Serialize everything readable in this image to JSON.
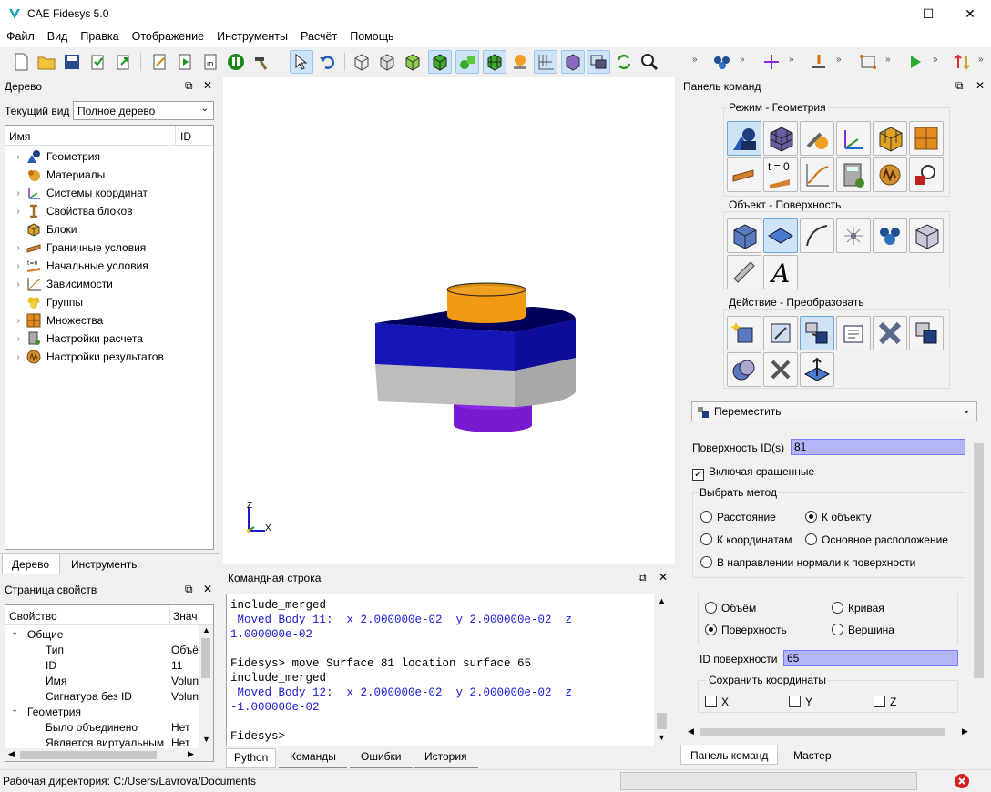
{
  "window": {
    "title": "CAE Fidesys 5.0",
    "min": "—",
    "max": "☐",
    "close": "✕"
  },
  "menu": [
    "Файл",
    "Вид",
    "Правка",
    "Отображение",
    "Инструменты",
    "Расчёт",
    "Помощь"
  ],
  "tree_panel": {
    "title": "Дерево",
    "view_label": "Текущий вид",
    "view_value": "Полное дерево",
    "col_name": "Имя",
    "col_id": "ID",
    "items": [
      {
        "label": "Геометрия",
        "icon": "geometry-icon",
        "expandable": true
      },
      {
        "label": "Материалы",
        "icon": "materials-icon",
        "expandable": false
      },
      {
        "label": "Системы координат",
        "icon": "axes-icon",
        "expandable": true
      },
      {
        "label": "Свойства блоков",
        "icon": "beam-icon",
        "expandable": true
      },
      {
        "label": "Блоки",
        "icon": "blocks-icon",
        "expandable": false
      },
      {
        "label": "Граничные условия",
        "icon": "boundary-icon",
        "expandable": true
      },
      {
        "label": "Начальные условия",
        "icon": "initial-icon",
        "expandable": true
      },
      {
        "label": "Зависимости",
        "icon": "graph-icon",
        "expandable": true
      },
      {
        "label": "Группы",
        "icon": "groups-icon",
        "expandable": false
      },
      {
        "label": "Множества",
        "icon": "sets-icon",
        "expandable": true
      },
      {
        "label": "Настройки расчета",
        "icon": "calc-settings-icon",
        "expandable": true
      },
      {
        "label": "Настройки результатов",
        "icon": "results-icon",
        "expandable": true
      }
    ],
    "tabs": [
      "Дерево",
      "Инструменты"
    ]
  },
  "props_panel": {
    "title": "Страница свойств",
    "col_prop": "Свойство",
    "col_val": "Знач",
    "rows": [
      {
        "name": "Общие",
        "value": "",
        "level": 0,
        "group": true
      },
      {
        "name": "Тип",
        "value": "Объё",
        "level": 1
      },
      {
        "name": "ID",
        "value": "11",
        "level": 1
      },
      {
        "name": "Имя",
        "value": "Volun",
        "level": 1
      },
      {
        "name": "Сигнатура без ID",
        "value": "Volun",
        "level": 1
      },
      {
        "name": "Геометрия",
        "value": "",
        "level": 0,
        "group": true
      },
      {
        "name": "Было объединено",
        "value": "Нет",
        "level": 1
      },
      {
        "name": "Является виртуальным",
        "value": "Нет",
        "level": 1
      }
    ]
  },
  "viewport": {
    "axis_z": "Z",
    "axis_x": "X"
  },
  "command_panel": {
    "title": "Командная строка",
    "lines": [
      {
        "text": "include_merged",
        "style": "plain"
      },
      {
        "text": " Moved Body 11:  x 2.000000e-02  y 2.000000e-02  z",
        "style": "blue"
      },
      {
        "text": "1.000000e-02",
        "style": "blue"
      },
      {
        "text": "",
        "style": "plain"
      },
      {
        "text": "Fidesys> move Surface 81 location surface 65",
        "style": "prompt"
      },
      {
        "text": "include_merged",
        "style": "plain"
      },
      {
        "text": " Moved Body 12:  x 2.000000e-02  y 2.000000e-02  z",
        "style": "blue"
      },
      {
        "text": "-1.000000e-02",
        "style": "blue"
      },
      {
        "text": "",
        "style": "plain"
      },
      {
        "text": "Fidesys>",
        "style": "prompt"
      }
    ],
    "tabs": [
      "Python",
      "Команды",
      "Ошибки",
      "История"
    ]
  },
  "right_panel": {
    "title": "Панель команд",
    "mode_group": "Режим - Геометрия",
    "object_group": "Объект - Поверхность",
    "action_group": "Действие - Преобразовать",
    "t0_label": "t = 0",
    "operation": "Переместить",
    "surface_ids_label": "Поверхность ID(s)",
    "surface_ids_value": "81",
    "include_merged": "Включая сращенные",
    "method_group": "Выбрать метод",
    "methods": {
      "distance": "Расстояние",
      "to_object": "К объекту",
      "to_coords": "К координатам",
      "home": "Основное расположение",
      "normal": "В направлении нормали к поверхности"
    },
    "targets": {
      "volume": "Объём",
      "curve": "Кривая",
      "surface": "Поверхность",
      "vertex": "Вершина"
    },
    "target_id_label": "ID поверхности",
    "target_id_value": "65",
    "keep_coords_group": "Сохранить координаты",
    "coord_x": "X",
    "coord_y": "Y",
    "coord_z": "Z",
    "tabs": [
      "Панель команд",
      "Мастер"
    ]
  },
  "status": {
    "workdir": "Рабочая директория: C:/Users/Lavrova/Documents"
  }
}
